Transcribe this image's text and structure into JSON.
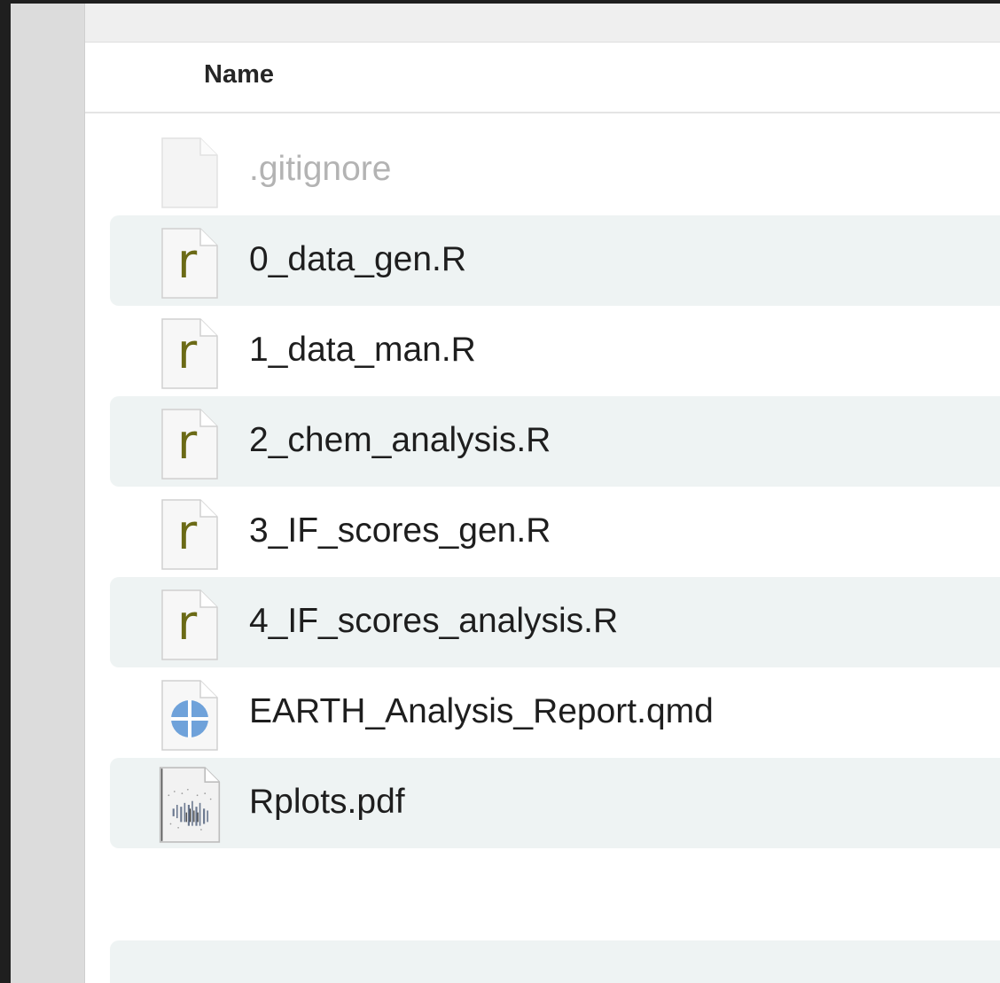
{
  "header": {
    "name_label": "Name"
  },
  "files": [
    {
      "name": ".gitignore",
      "icon": "blank-document-icon",
      "dimmed": true
    },
    {
      "name": "0_data_gen.R",
      "icon": "r-script-icon",
      "dimmed": false
    },
    {
      "name": "1_data_man.R",
      "icon": "r-script-icon",
      "dimmed": false
    },
    {
      "name": "2_chem_analysis.R",
      "icon": "r-script-icon",
      "dimmed": false
    },
    {
      "name": "3_IF_scores_gen.R",
      "icon": "r-script-icon",
      "dimmed": false
    },
    {
      "name": "4_IF_scores_analysis.R",
      "icon": "r-script-icon",
      "dimmed": false
    },
    {
      "name": "EARTH_Analysis_Report.qmd",
      "icon": "quarto-document-icon",
      "dimmed": false
    },
    {
      "name": "Rplots.pdf",
      "icon": "pdf-thumbnail-icon",
      "dimmed": false
    }
  ],
  "colors": {
    "row_alt": "#eef3f3",
    "r_letter": "#6b6a16",
    "quarto_blue": "#6fa2da"
  }
}
